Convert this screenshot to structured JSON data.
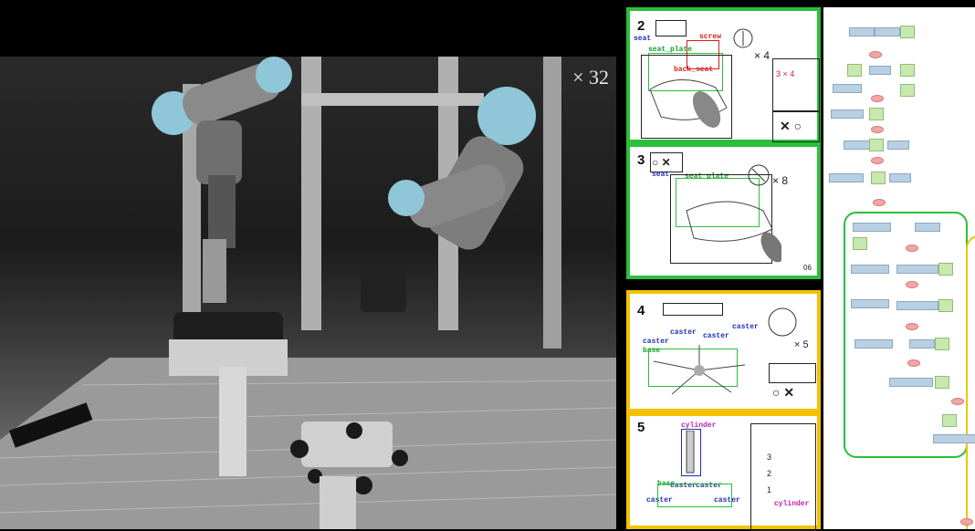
{
  "video": {
    "speed_label": "× 32"
  },
  "steps": [
    {
      "num": "2",
      "labels": [
        "seat",
        "seat_plate",
        "screw",
        "back_seat"
      ],
      "badge": "× 4",
      "mini_badge": "3  × 4",
      "page": ""
    },
    {
      "num": "3",
      "labels": [
        "seat",
        "seat_plate"
      ],
      "badge": "× 8",
      "page": "06"
    },
    {
      "num": "4",
      "labels": [
        "caster",
        "caster",
        "caster",
        "caster",
        "base"
      ],
      "badge": "× 5"
    },
    {
      "num": "5",
      "labels": [
        "cylinder",
        "base",
        "caster",
        "caster",
        "caster",
        "caster",
        "cylinder"
      ],
      "side_steps": [
        "3",
        "2",
        "1"
      ]
    }
  ],
  "colors": {
    "green_frame": "#2bbf3a",
    "yellow_frame": "#f2c200"
  }
}
